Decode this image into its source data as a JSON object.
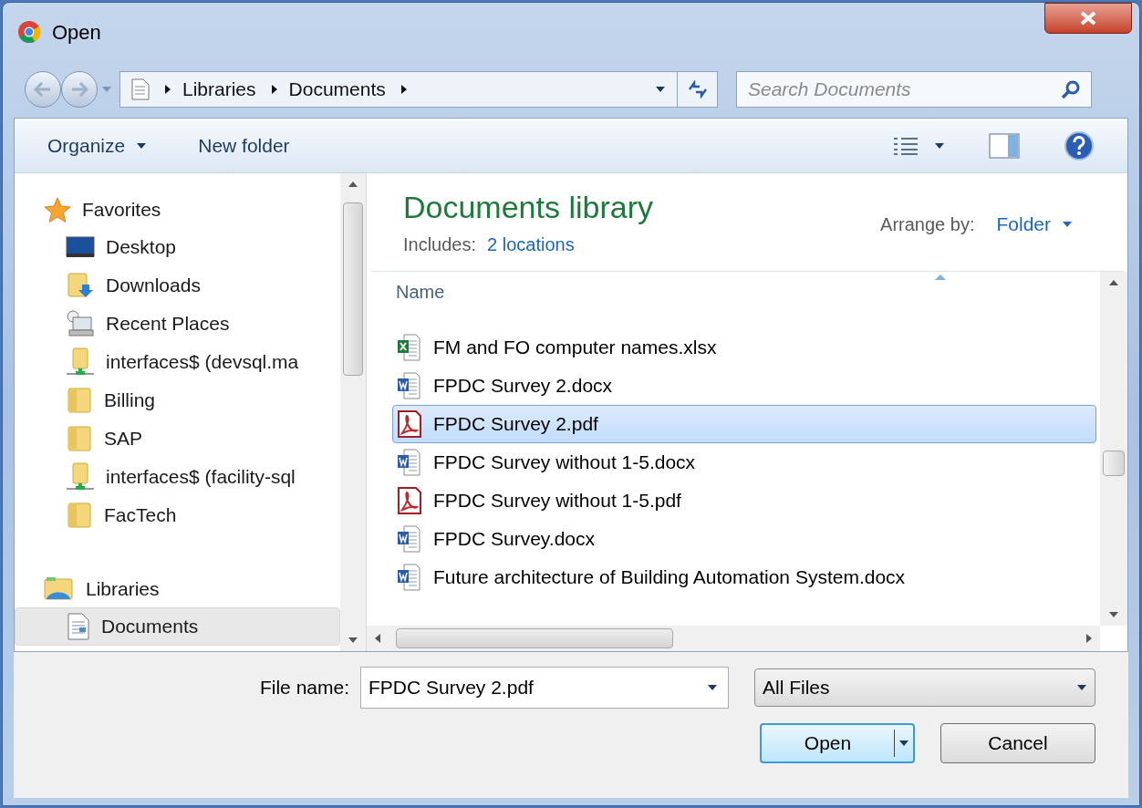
{
  "window": {
    "title": "Open"
  },
  "address": {
    "crumbs": [
      "Libraries",
      "Documents"
    ]
  },
  "search": {
    "placeholder": "Search Documents"
  },
  "toolbar": {
    "organize": "Organize",
    "new_folder": "New folder"
  },
  "nav": [
    {
      "label": "Favorites",
      "kind": "favorites",
      "children": [
        {
          "label": "Desktop",
          "kind": "desktop",
          "selected": false
        },
        {
          "label": "Downloads",
          "kind": "downloads",
          "selected": false
        },
        {
          "label": "Recent Places",
          "kind": "recent",
          "selected": false
        },
        {
          "label": "interfaces$ (devsql.ma",
          "kind": "network",
          "selected": false
        },
        {
          "label": "Billing",
          "kind": "folder",
          "selected": false
        },
        {
          "label": "SAP",
          "kind": "folder",
          "selected": false
        },
        {
          "label": "interfaces$ (facility-sql",
          "kind": "network",
          "selected": false
        },
        {
          "label": "FacTech",
          "kind": "folder",
          "selected": false
        }
      ]
    },
    {
      "label": "Libraries",
      "kind": "libraries",
      "children": [
        {
          "label": "Documents",
          "kind": "documents",
          "selected": true
        }
      ]
    }
  ],
  "library": {
    "title": "Documents library",
    "includes_label": "Includes:",
    "includes_link": "2 locations",
    "arrange_label": "Arrange by:",
    "arrange_value": "Folder"
  },
  "columns": [
    "Name"
  ],
  "files": [
    {
      "name": "FM and FO computer names.xlsx",
      "kind": "xlsx",
      "selected": false
    },
    {
      "name": "FPDC Survey 2.docx",
      "kind": "docx",
      "selected": false
    },
    {
      "name": "FPDC Survey 2.pdf",
      "kind": "pdf",
      "selected": true
    },
    {
      "name": "FPDC Survey without 1-5.docx",
      "kind": "docx",
      "selected": false
    },
    {
      "name": "FPDC Survey without 1-5.pdf",
      "kind": "pdf",
      "selected": false
    },
    {
      "name": "FPDC Survey.docx",
      "kind": "docx",
      "selected": false
    },
    {
      "name": "Future architecture of Building Automation System.docx",
      "kind": "docx",
      "selected": false
    }
  ],
  "file_name": {
    "label": "File name:",
    "value": "FPDC Survey 2.pdf"
  },
  "filter": {
    "value": "All Files"
  },
  "buttons": {
    "open": "Open",
    "cancel": "Cancel"
  }
}
